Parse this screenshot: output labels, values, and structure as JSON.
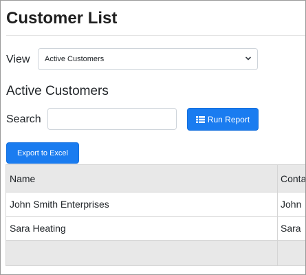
{
  "page": {
    "title": "Customer List"
  },
  "view": {
    "label": "View",
    "selected": "Active Customers"
  },
  "section": {
    "title": "Active Customers"
  },
  "search": {
    "label": "Search",
    "value": "",
    "placeholder": ""
  },
  "toolbar": {
    "run_report_label": "Run Report",
    "run_report_icon": "grid-icon",
    "export_label": "Export to Excel"
  },
  "colors": {
    "primary": "#1a7cf0",
    "header_bg": "#e8e8e8"
  },
  "table": {
    "columns": [
      "Name",
      "Contact"
    ],
    "visible_columns": [
      "Name",
      "Conta"
    ],
    "rows": [
      {
        "name": "John Smith Enterprises",
        "contact": "John"
      },
      {
        "name": "Sara Heating",
        "contact": "Sara"
      }
    ]
  }
}
